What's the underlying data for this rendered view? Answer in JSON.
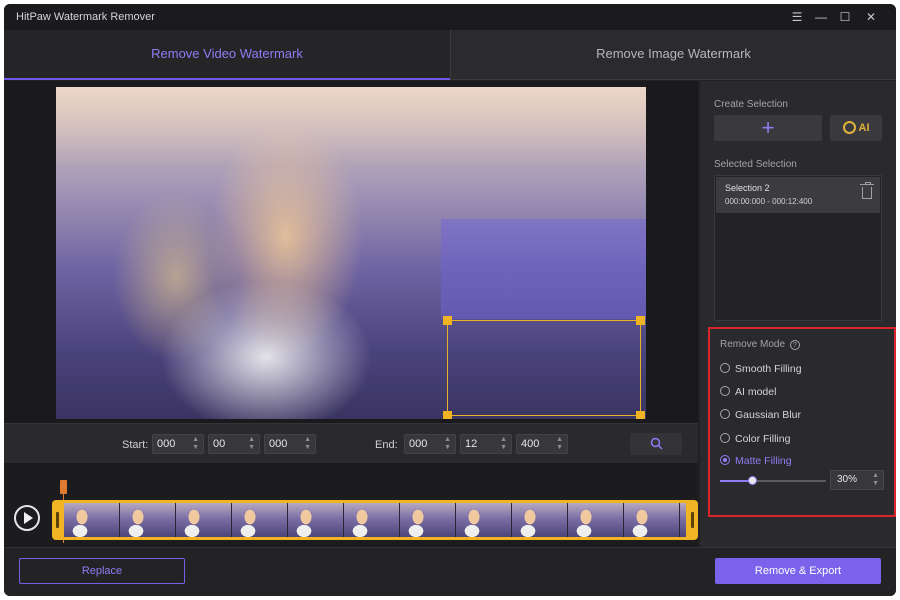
{
  "window": {
    "title": "HitPaw Watermark Remover",
    "controls": {
      "menu": "☰",
      "minimize": "—",
      "maximize": "☐",
      "close": "✕"
    }
  },
  "tabs": [
    {
      "label": "Remove Video Watermark",
      "active": true
    },
    {
      "label": "Remove Image Watermark",
      "active": false
    }
  ],
  "time_controls": {
    "start_label": "Start:",
    "start": [
      "000",
      "00",
      "000"
    ],
    "end_label": "End:",
    "end": [
      "000",
      "12",
      "400"
    ],
    "zoom_icon": "magnifier-icon"
  },
  "right_panel": {
    "create_selection_label": "Create Selection",
    "add_icon": "+",
    "ai_label": "AI",
    "selected_selection_label": "Selected Selection",
    "selections": [
      {
        "name": "Selection 2",
        "range": "000:00:000 - 000:12:400"
      }
    ],
    "remove_mode": {
      "title": "Remove Mode",
      "help_icon": "?",
      "options": [
        {
          "label": "Smooth Filling",
          "selected": false
        },
        {
          "label": "AI model",
          "selected": false
        },
        {
          "label": "Gaussian Blur",
          "selected": false
        },
        {
          "label": "Color Filling",
          "selected": false
        },
        {
          "label": "Matte Filling",
          "selected": true
        }
      ],
      "matte_level": 30,
      "matte_display": "30%"
    }
  },
  "bottom": {
    "replace_label": "Replace",
    "export_label": "Remove & Export"
  },
  "colors": {
    "accent": "#7a62ea",
    "selection_handle": "#f0b323",
    "highlight_border": "#d7262c"
  }
}
